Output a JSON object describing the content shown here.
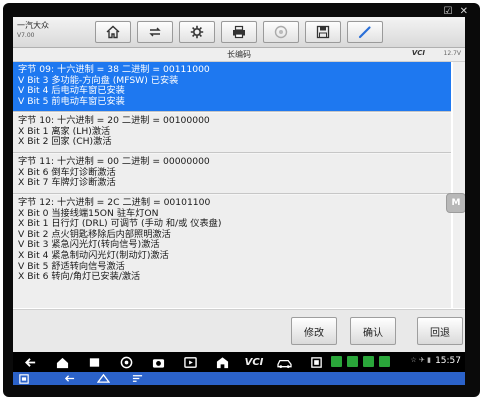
{
  "window_corner": "☑ ✕",
  "brand": {
    "name": "一汽大众",
    "version": "V7.00"
  },
  "toolbar_icons": [
    "home-icon",
    "vehicle-swap-icon",
    "settings-gear-icon",
    "printer-icon",
    "help-icon",
    "save-icon",
    "edit-pen-icon"
  ],
  "status": {
    "title": "长编码",
    "vci": "VCI",
    "battery": "12.7V"
  },
  "rows": [
    {
      "selected": true,
      "lines": [
        "字节 09: 十六进制 = 38  二进制 = 00111000",
        "V Bit 3 多功能-方向盘 (MFSW) 已安装",
        "V Bit 4 后电动车窗已安装",
        "V Bit 5 前电动车窗已安装"
      ]
    },
    {
      "selected": false,
      "lines": [
        "字节 10: 十六进制 = 20  二进制 = 00100000",
        "X Bit 1 离家 (LH)激活",
        "X Bit 2 回家 (CH)激活"
      ]
    },
    {
      "selected": false,
      "lines": [
        "字节 11: 十六进制 = 00  二进制 = 00000000",
        "X Bit 6 倒车灯诊断激活",
        "X Bit 7 车牌灯诊断激活"
      ]
    },
    {
      "selected": false,
      "lines": [
        "字节 12: 十六进制 = 2C  二进制 = 00101100",
        "X Bit 0 当接线端15ON 驻车灯ON",
        "X Bit 1 日行灯 (DRL) 可调节 (手动  和/或 仪表盘)",
        "V Bit 2 点火钥匙移除后内部照明激活",
        "V Bit 3 紧急闪光灯(转向信号)激活",
        "X Bit 4 紧急制动闪光灯(制动灯)激活",
        "V Bit 5 舒适转向信号激活",
        "X Bit 6 转向/角灯已安装/激活"
      ]
    }
  ],
  "side_handle": "M",
  "actions": {
    "modify": "修改",
    "confirm": "确认",
    "back": "回退"
  },
  "nav": {
    "vci": "VCI",
    "signal": "☆ ✈ ▮",
    "time": "15:57"
  }
}
